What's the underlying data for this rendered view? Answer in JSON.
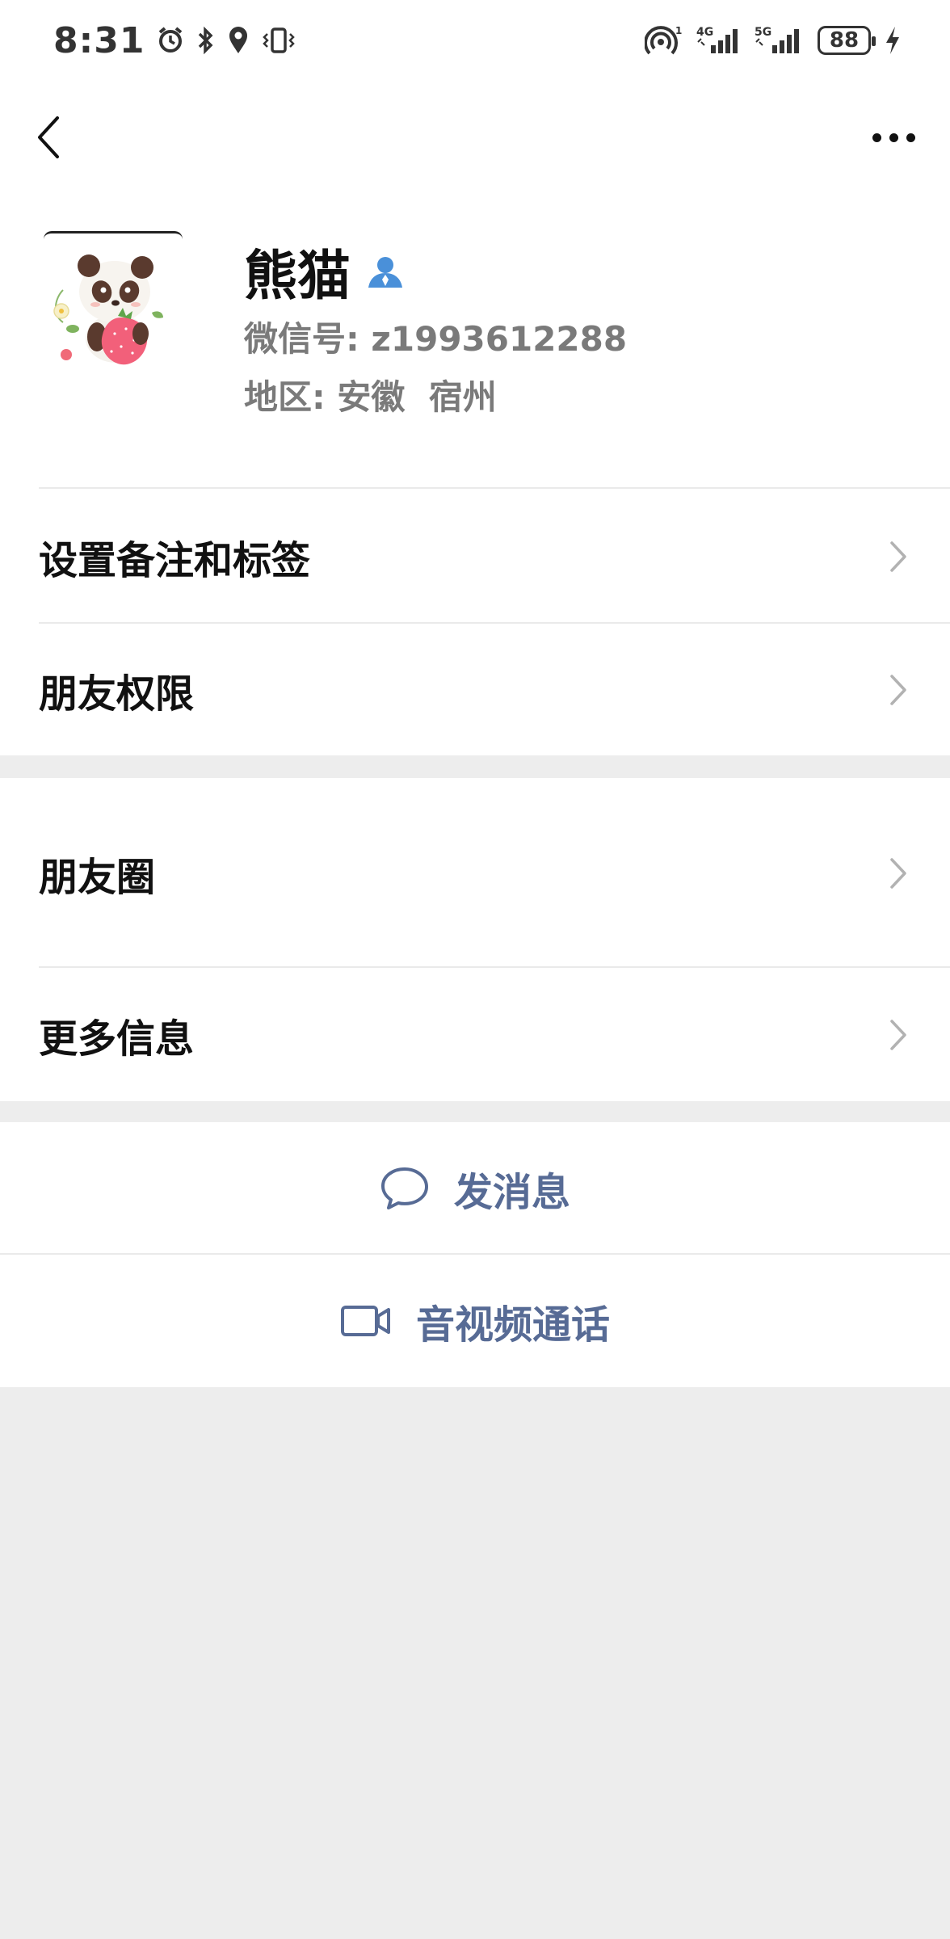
{
  "status_bar": {
    "time": "8:31",
    "battery": "88",
    "network_1": "4G",
    "network_2": "5G",
    "hotspot_count": "1",
    "icons": [
      "alarm-icon",
      "bluetooth-icon",
      "location-icon",
      "vibrate-icon",
      "hotspot-icon",
      "signal-icon",
      "charging-icon"
    ]
  },
  "nav": {
    "back_icon": "back-chevron-icon",
    "more_icon": "more-dots-icon"
  },
  "profile": {
    "name": "熊猫",
    "wechat_id_label": "微信号:",
    "wechat_id": "z1993612288",
    "region_label": "地区:",
    "region_province": "安徽",
    "region_city": "宿州",
    "avatar_desc_icon": "panda-avatar",
    "badge_icon": "contact-person-icon",
    "badge_color": "#4a90d9"
  },
  "cells": {
    "remark_tags": "设置备注和标签",
    "friend_permission": "朋友权限",
    "moments": "朋友圈",
    "more_info": "更多信息"
  },
  "actions": {
    "send_message": "发消息",
    "av_call": "音视频通话",
    "accent_color": "#576b95"
  }
}
